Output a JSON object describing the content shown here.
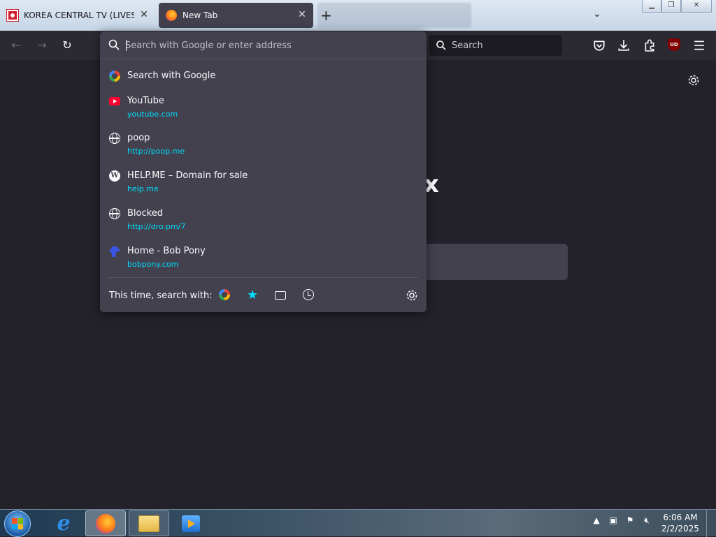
{
  "tabs": [
    {
      "title": "KOREA CENTRAL TV (LIVESTREAM)",
      "close": "✕",
      "favicon": "kctv-flag-icon"
    },
    {
      "title": "New Tab",
      "close": "✕",
      "favicon": "firefox-icon"
    }
  ],
  "tabstrip": {
    "new_tab": "+",
    "list_all_tabs": "⌄"
  },
  "window_controls": {
    "minimize": "▁",
    "restore": "❐",
    "close": "✕"
  },
  "navbar": {
    "back": "←",
    "forward": "→",
    "reload": "↻",
    "search_placeholder": "Search",
    "ublock_label": "UD"
  },
  "urlbar": {
    "placeholder": "Search with Google or enter address",
    "value": "",
    "results": [
      {
        "title": "Search with Google",
        "url": "",
        "icon": "google-icon"
      },
      {
        "title": "YouTube",
        "url": "youtube.com",
        "icon": "youtube-icon"
      },
      {
        "title": "poop",
        "url": "http://poop.me",
        "icon": "globe-icon"
      },
      {
        "title": "HELP.ME – Domain for sale",
        "url": "help.me",
        "icon": "wordpress-icon"
      },
      {
        "title": "Blocked",
        "url": "http://dro.pm/7",
        "icon": "globe-icon"
      },
      {
        "title": "Home - Bob Pony",
        "url": "bobpony.com",
        "icon": "bobpony-icon"
      }
    ],
    "one_off_label": "This time, search with:",
    "one_off_buttons": [
      "google-icon",
      "bookmarks-star-icon",
      "tabs-icon",
      "history-icon",
      "gear-icon"
    ]
  },
  "content": {
    "logo_fragment": "x"
  },
  "colors": {
    "accent_url": "#00ddff",
    "panel_bg": "#42414d",
    "page_bg": "#23222b",
    "toolbar_bg": "#2b2a33"
  },
  "taskbar": {
    "apps": [
      "internet-explorer-icon",
      "firefox-icon",
      "file-explorer-icon",
      "media-player-icon"
    ],
    "time": "6:06 AM",
    "date": "2/2/2025"
  }
}
